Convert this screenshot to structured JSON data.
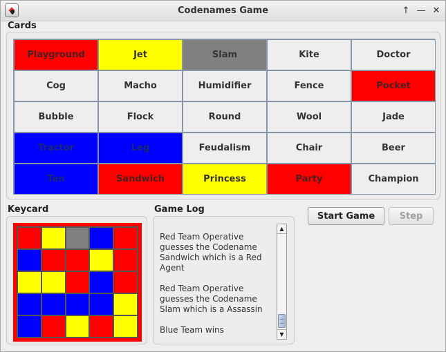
{
  "window": {
    "title": "Codenames Game",
    "controls": [
      "↑",
      "—",
      "✕"
    ]
  },
  "labels": {
    "cards": "Cards",
    "keycard": "Keycard",
    "game_log": "Game Log"
  },
  "colors": {
    "red": "#ff0000",
    "blue": "#0000ff",
    "yellow": "#ffff00",
    "gray": "#808080",
    "neutral": "#eeeeee"
  },
  "cards": [
    {
      "word": "Playground",
      "color": "red"
    },
    {
      "word": "Jet",
      "color": "yellow"
    },
    {
      "word": "Slam",
      "color": "gray"
    },
    {
      "word": "Kite",
      "color": "neutral"
    },
    {
      "word": "Doctor",
      "color": "neutral"
    },
    {
      "word": "Cog",
      "color": "neutral"
    },
    {
      "word": "Macho",
      "color": "neutral"
    },
    {
      "word": "Humidifier",
      "color": "neutral"
    },
    {
      "word": "Fence",
      "color": "neutral"
    },
    {
      "word": "Pocket",
      "color": "red"
    },
    {
      "word": "Bubble",
      "color": "neutral"
    },
    {
      "word": "Flock",
      "color": "neutral"
    },
    {
      "word": "Round",
      "color": "neutral"
    },
    {
      "word": "Wool",
      "color": "neutral"
    },
    {
      "word": "Jade",
      "color": "neutral"
    },
    {
      "word": "Tractor",
      "color": "blue"
    },
    {
      "word": "Leg",
      "color": "blue"
    },
    {
      "word": "Feudalism",
      "color": "neutral"
    },
    {
      "word": "Chair",
      "color": "neutral"
    },
    {
      "word": "Beer",
      "color": "neutral"
    },
    {
      "word": "Ten",
      "color": "blue"
    },
    {
      "word": "Sandwich",
      "color": "red"
    },
    {
      "word": "Princess",
      "color": "yellow"
    },
    {
      "word": "Party",
      "color": "red"
    },
    {
      "word": "Champion",
      "color": "neutral"
    }
  ],
  "keycard": {
    "border_color": "red",
    "cells": [
      "red",
      "yellow",
      "gray",
      "blue",
      "red",
      "blue",
      "red",
      "red",
      "yellow",
      "red",
      "yellow",
      "yellow",
      "red",
      "blue",
      "red",
      "blue",
      "blue",
      "blue",
      "blue",
      "yellow",
      "blue",
      "red",
      "yellow",
      "red",
      "yellow"
    ]
  },
  "game_log": {
    "lines": [
      "Red Team Operative",
      "guesses the Codename",
      "Sandwich which is a Red",
      "Agent",
      "",
      "Red Team Operative",
      "guesses the Codename",
      "Slam which is a Assassin",
      "",
      "Blue Team wins"
    ]
  },
  "buttons": {
    "start": "Start Game",
    "step": "Step"
  }
}
